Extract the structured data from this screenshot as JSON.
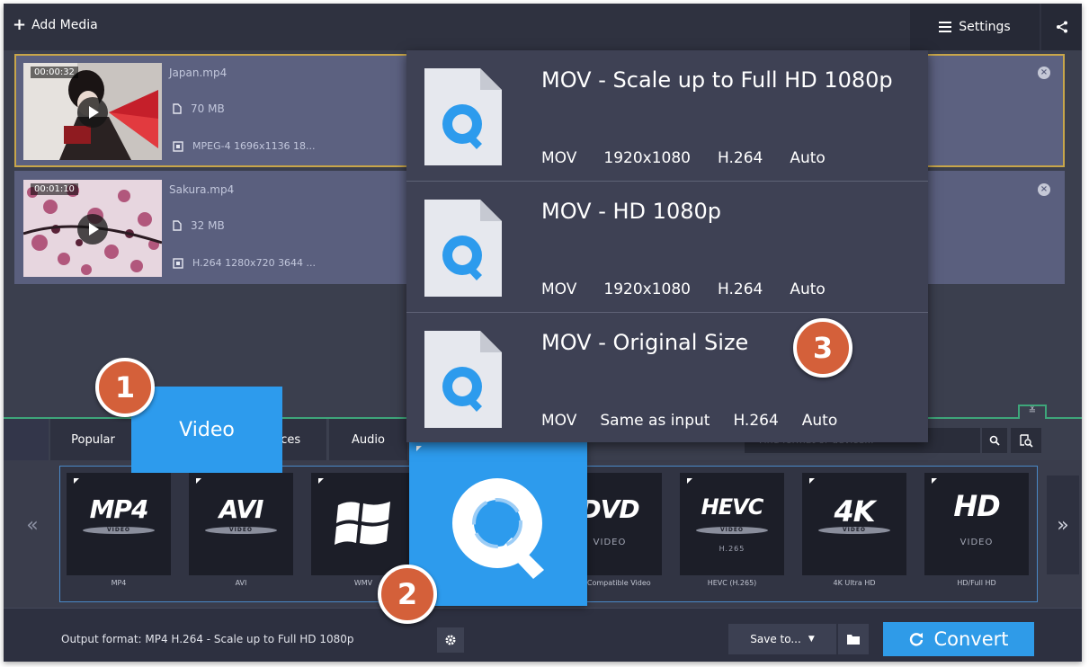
{
  "topbar": {
    "add_media": "Add Media",
    "settings": "Settings"
  },
  "files": [
    {
      "time": "00:00:32",
      "name": "Japan.mp4",
      "size": "70 MB",
      "codec": "MPEG-4 1696x1136 18..."
    },
    {
      "time": "00:01:10",
      "name": "Sakura.mp4",
      "size": "32 MB",
      "codec": "H.264 1280x720 3644 ..."
    }
  ],
  "tabs": {
    "popular": "Popular",
    "video": "Video",
    "devices": "Devices",
    "audio": "Audio"
  },
  "search": {
    "placeholder": "Find format or device..."
  },
  "formats": [
    {
      "logo": "MP4",
      "disc": "VIDEO",
      "sub": "",
      "label": "MP4"
    },
    {
      "logo": "AVI",
      "disc": "VIDEO",
      "sub": "",
      "label": "AVI"
    },
    {
      "logo": "",
      "disc": "",
      "sub": "",
      "label": "WMV"
    },
    {
      "logo": "DVD",
      "disc": "",
      "sub": "VIDEO",
      "label": "DVD-Compatible Video"
    },
    {
      "logo": "HEVC",
      "disc": "VIDEO",
      "sub": "H.265",
      "label": "HEVC (H.265)"
    },
    {
      "logo": "4K",
      "disc": "VIDEO",
      "sub": "",
      "label": "4K Ultra HD"
    },
    {
      "logo": "HD",
      "disc": "",
      "sub": "VIDEO",
      "label": "HD/Full HD"
    }
  ],
  "dropdown": [
    {
      "title": "MOV - Scale up to Full HD 1080p",
      "container": "MOV",
      "resolution": "1920x1080",
      "codec": "H.264",
      "bitrate": "Auto"
    },
    {
      "title": "MOV - HD 1080p",
      "container": "MOV",
      "resolution": "1920x1080",
      "codec": "H.264",
      "bitrate": "Auto"
    },
    {
      "title": "MOV - Original Size",
      "container": "MOV",
      "resolution": "Same as input",
      "codec": "H.264",
      "bitrate": "Auto"
    }
  ],
  "bottombar": {
    "output_format": "Output format: MP4 H.264 - Scale up to Full HD 1080p",
    "save_to": "Save to...",
    "convert": "Convert"
  },
  "badges": {
    "step1": "1",
    "step2": "2",
    "step3": "3"
  },
  "colors": {
    "accent_blue": "#2f9be8",
    "badge_orange": "#d4603a",
    "selected_border": "#c8a64a",
    "panel_green": "#3ea67a"
  }
}
